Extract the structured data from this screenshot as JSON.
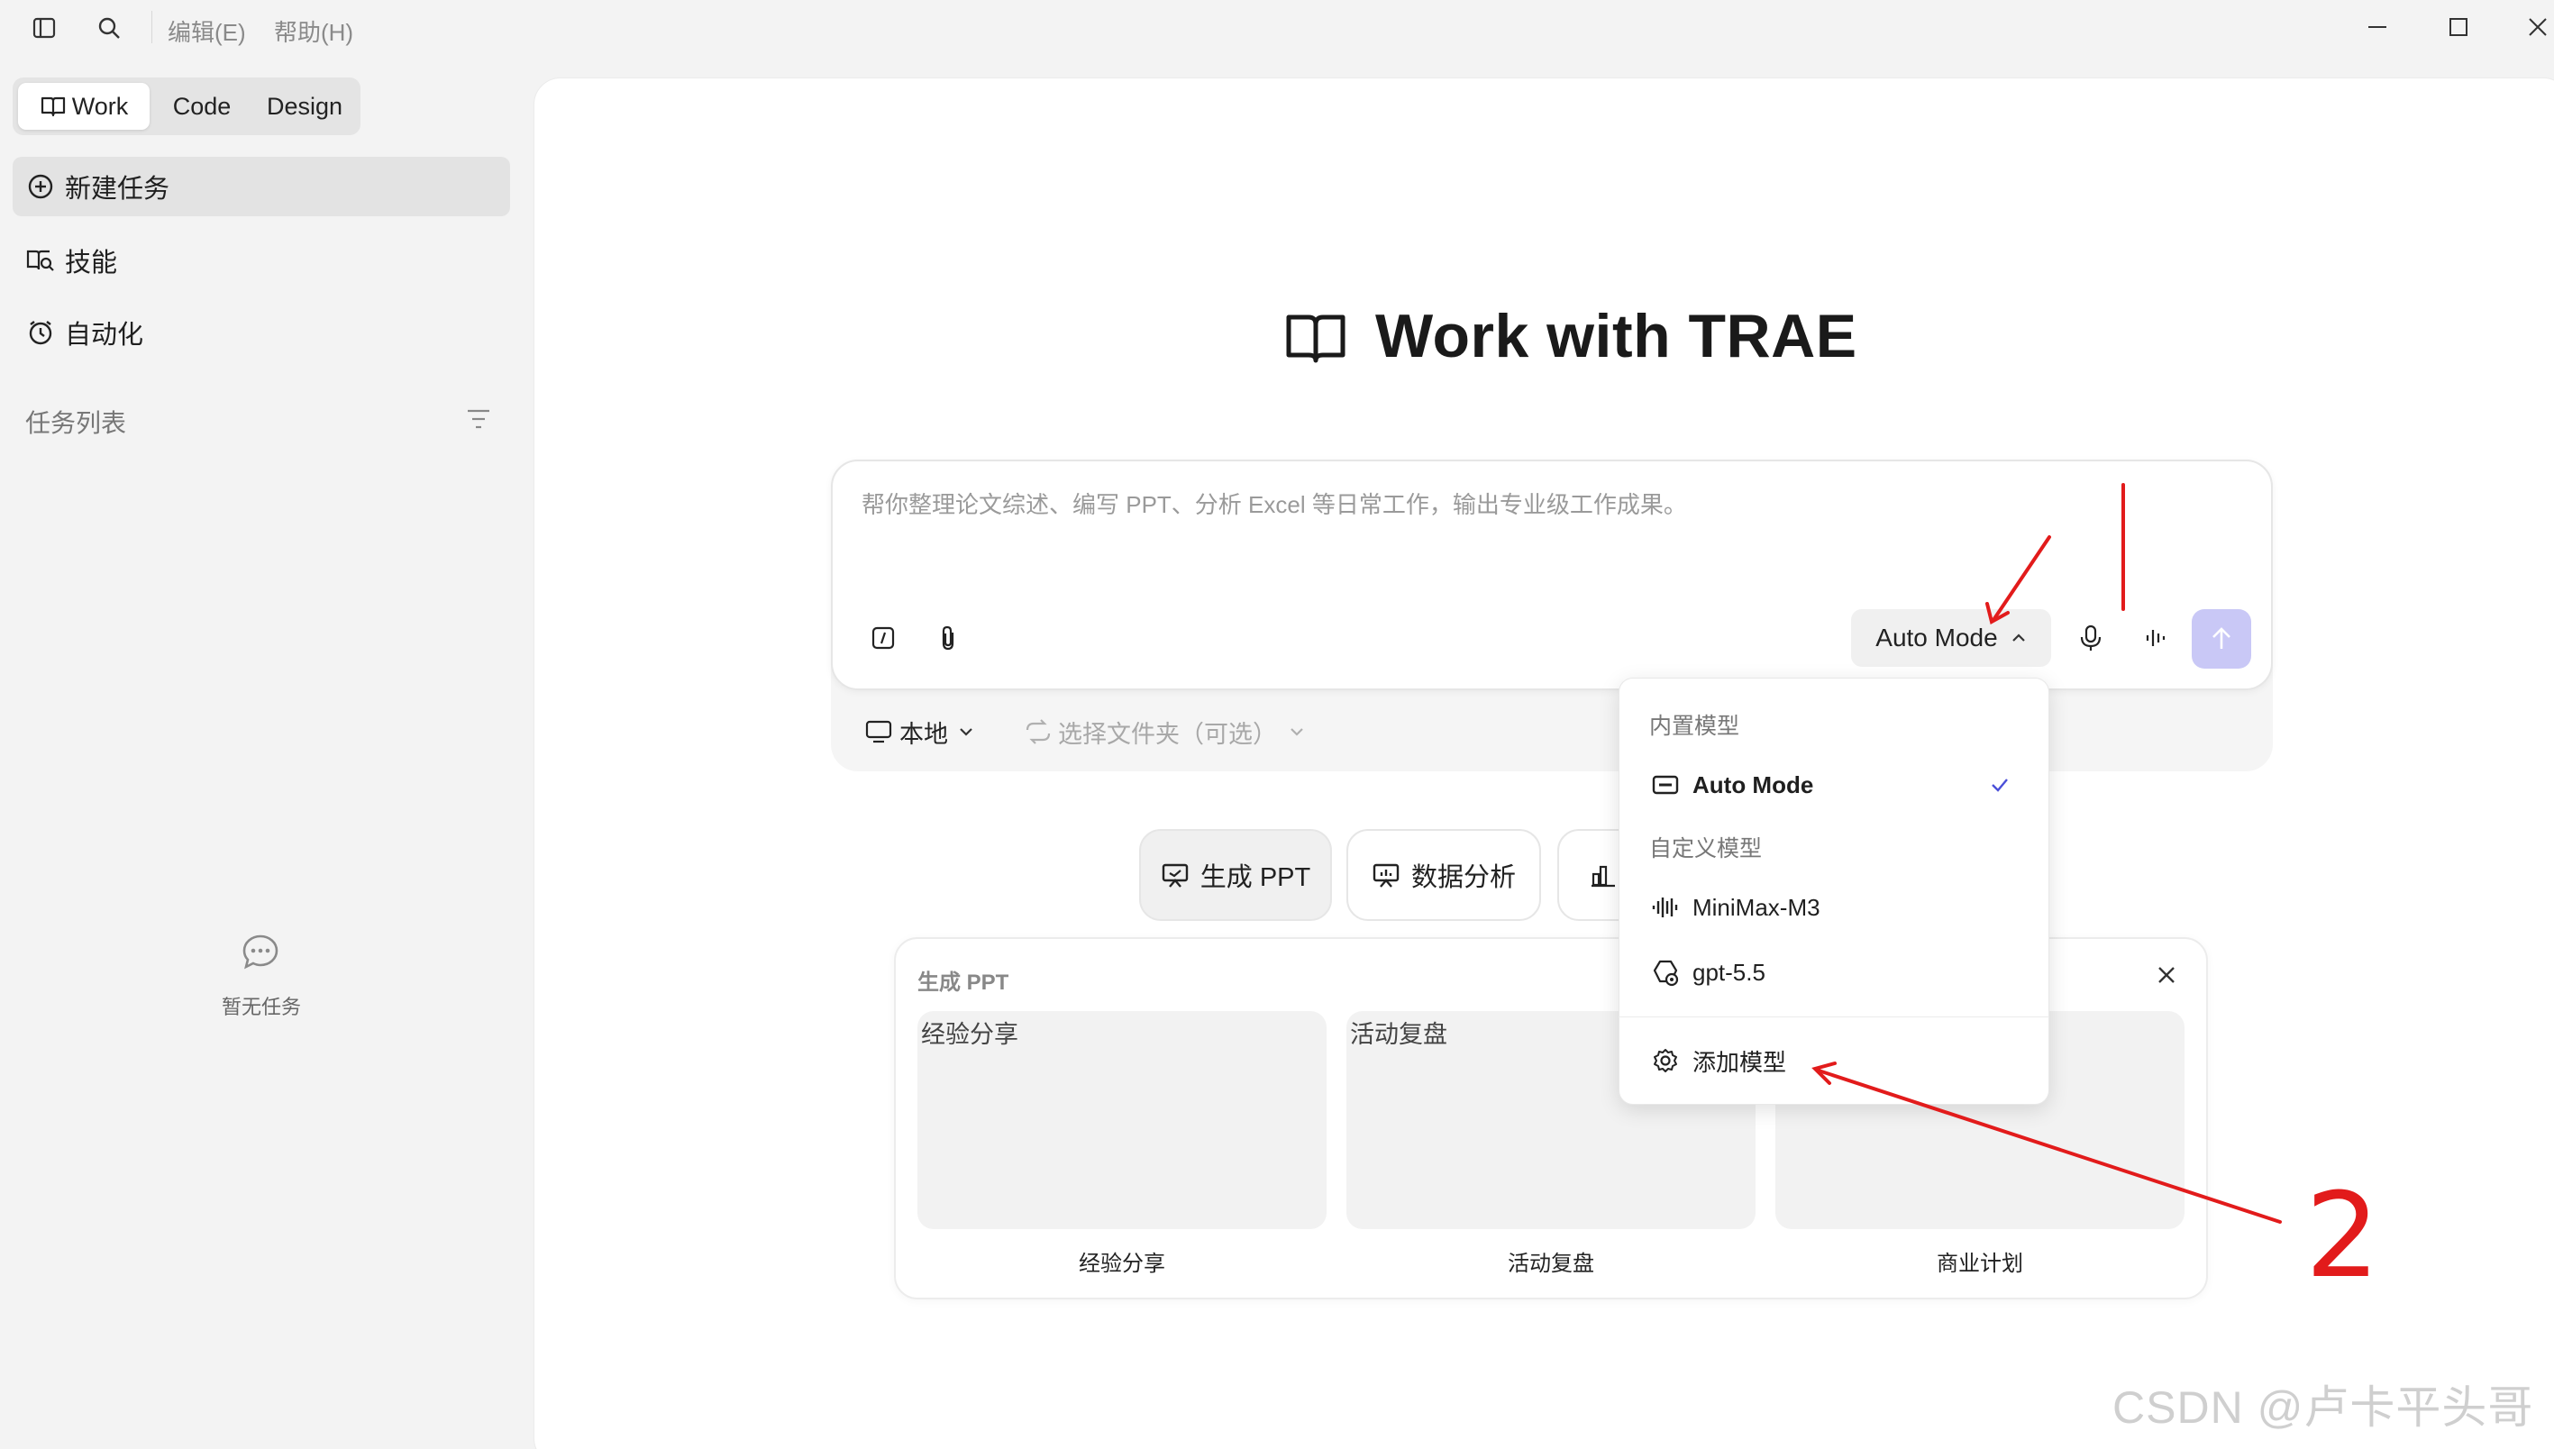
{
  "titlebar": {
    "menus": [
      "编辑(E)",
      "帮助(H)"
    ]
  },
  "sidebar": {
    "tabs": [
      {
        "label": "Work",
        "active": true
      },
      {
        "label": "Code",
        "active": false
      },
      {
        "label": "Design",
        "active": false
      }
    ],
    "nav": [
      {
        "label": "新建任务",
        "icon": "plus-circle-icon",
        "active": true
      },
      {
        "label": "技能",
        "icon": "book-search-icon",
        "active": false
      },
      {
        "label": "自动化",
        "icon": "alarm-clock-icon",
        "active": false
      }
    ],
    "tasklist_title": "任务列表",
    "empty_text": "暂无任务"
  },
  "main": {
    "hero_title": "Work with TRAE",
    "input": {
      "placeholder": "帮你整理论文综述、编写 PPT、分析 Excel 等日常工作，输出专业级工作成果。",
      "mode_label": "Auto Mode"
    },
    "location": {
      "local_label": "本地",
      "folder_label": "选择文件夹（可选）"
    },
    "chips": [
      {
        "label": "生成 PPT",
        "icon": "presentation-icon",
        "active": true
      },
      {
        "label": "数据分析",
        "icon": "chart-board-icon",
        "active": false
      }
    ],
    "gen_panel": {
      "title": "生成 PPT",
      "cards": [
        {
          "alt": "经验分享",
          "label": "经验分享"
        },
        {
          "alt": "活动复盘",
          "label": "活动复盘"
        },
        {
          "alt": "",
          "label": "商业计划"
        }
      ]
    }
  },
  "dropdown": {
    "builtin_group": "内置模型",
    "builtin_items": [
      {
        "label": "Auto Mode",
        "icon": "auto-mode-icon",
        "selected": true
      }
    ],
    "custom_group": "自定义模型",
    "custom_items": [
      {
        "label": "MiniMax-M3",
        "icon": "waveform-icon"
      },
      {
        "label": "gpt-5.5",
        "icon": "model-settings-icon"
      }
    ],
    "add_label": "添加模型"
  },
  "annotations": {
    "number_label": "2"
  },
  "watermark": "CSDN @卢卡平头哥",
  "colors": {
    "send_button": "#c9c8f6",
    "check_mark": "#4a4fd8",
    "annotation_red": "#e21b1b"
  }
}
